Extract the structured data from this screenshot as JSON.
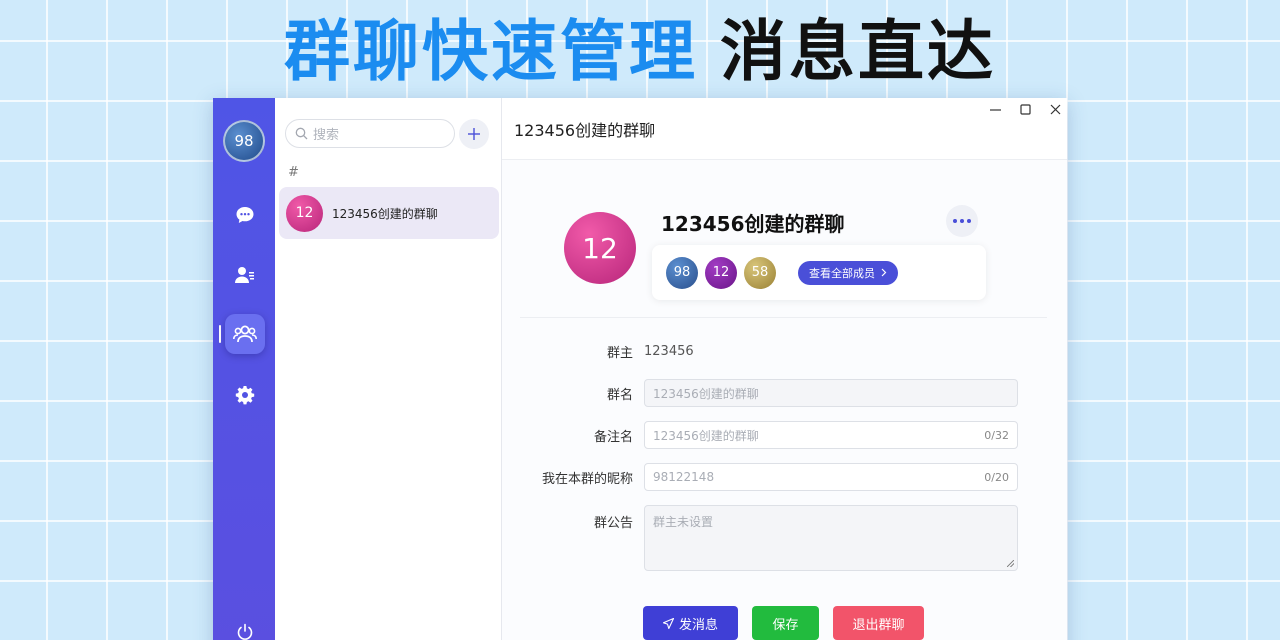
{
  "banner": {
    "part1": "群聊快速管理",
    "part2": "消息直达"
  },
  "rail": {
    "avatar_text": "98",
    "items": [
      {
        "icon": "chat-bubble-icon"
      },
      {
        "icon": "contacts-icon"
      },
      {
        "icon": "group-icon",
        "active": true
      },
      {
        "icon": "gear-icon"
      },
      {
        "icon": "power-icon"
      }
    ]
  },
  "list": {
    "search_placeholder": "搜索",
    "section_label": "#",
    "conversations": [
      {
        "avatar_text": "12",
        "name": "123456创建的群聊",
        "selected": true
      }
    ]
  },
  "main": {
    "header_title": "123456创建的群聊",
    "group": {
      "avatar_text": "12",
      "name": "123456创建的群聊",
      "members": [
        "98",
        "12",
        "58"
      ],
      "view_all_label": "查看全部成员"
    },
    "form": {
      "owner_label": "群主",
      "owner_value": "123456",
      "name_label": "群名",
      "name_placeholder": "123456创建的群聊",
      "remark_label": "备注名",
      "remark_placeholder": "123456创建的群聊",
      "remark_count": "0/32",
      "nick_label": "我在本群的昵称",
      "nick_placeholder": "98122148",
      "nick_count": "0/20",
      "notice_label": "群公告",
      "notice_placeholder": "群主未设置"
    },
    "buttons": {
      "send": "发消息",
      "save": "保存",
      "quit": "退出群聊"
    }
  },
  "colors": {
    "accent": "#4a4fd8",
    "rail": "#4f55e6",
    "save": "#22bb3e",
    "quit": "#f2546a",
    "banner_blue": "#1b8cf0"
  }
}
